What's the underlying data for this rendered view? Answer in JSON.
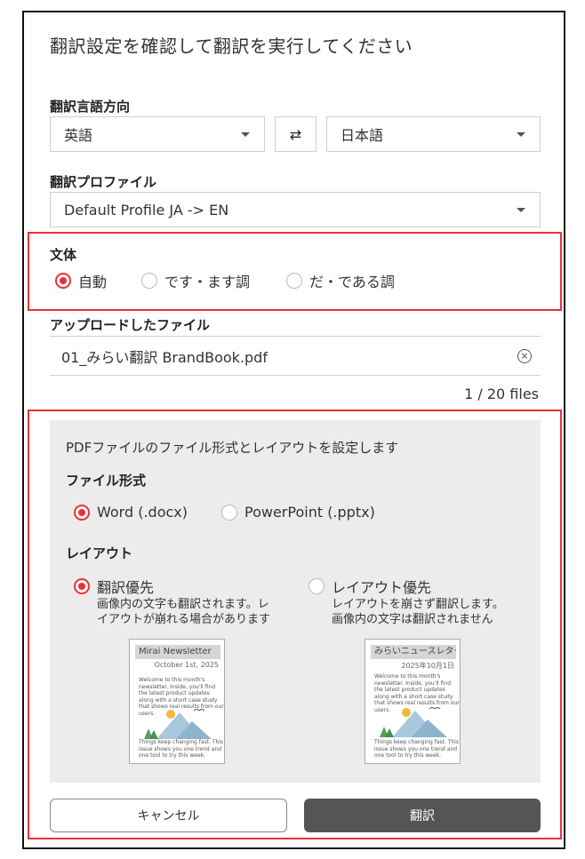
{
  "dialog": {
    "title": "翻訳設定を確認して翻訳を実行してください"
  },
  "language": {
    "label": "翻訳言語方向",
    "source": "英語",
    "target": "日本語",
    "swap_symbol": "⇄"
  },
  "profile": {
    "label": "翻訳プロファイル",
    "value": "Default Profile JA -> EN"
  },
  "style": {
    "label": "文体",
    "options": [
      "自動",
      "です・ます調",
      "だ・である調"
    ],
    "selected": "自動"
  },
  "uploaded": {
    "label": "アップロードしたファイル",
    "filename": "01_みらい翻訳 BrandBook.pdf",
    "count": "1 / 20 files"
  },
  "pdf_settings": {
    "heading": "PDFファイルのファイル形式とレイアウトを設定します",
    "format_label": "ファイル形式",
    "format_options": [
      "Word (.docx)",
      "PowerPoint (.pptx)"
    ],
    "format_selected": "Word (.docx)",
    "layout_label": "レイアウト",
    "layout_options": [
      {
        "label": "翻訳優先",
        "desc_line1": "画像内の文字も翻訳されます。レ",
        "desc_line2": "イアウトが崩れる場合があります",
        "thumb_title": "Mirai Newsletter",
        "thumb_date": "October 1st, 2025",
        "thumb_text1": "Welcome to this month's newsletter. Inside, you'll find the latest product updates along with a short case study that shows real results from our users.",
        "thumb_text2": "Things keep changing fast. This issue shows you one trend and one tool to try this week."
      },
      {
        "label": "レイアウト優先",
        "desc_line1": "レイアウトを崩さず翻訳します。",
        "desc_line2": "画像内の文字は翻訳されません",
        "thumb_title": "みらいニュースレター",
        "thumb_date": "2025年10月1日",
        "thumb_text1": "Welcome to this month's newsletter. Inside, you'll find the latest product updates along with a short case study that shows real results from our users.",
        "thumb_text2": "Things keep changing fast. This issue shows you one trend and one tool to try this week."
      }
    ],
    "layout_selected": "翻訳優先"
  },
  "actions": {
    "cancel": "キャンセル",
    "translate": "翻訳"
  },
  "colors": {
    "accent": "#e53238",
    "primary_button": "#555555"
  },
  "icons": {
    "dropdown": "chevron-down-icon",
    "swap": "swap-arrows-icon",
    "remove_file": "close-circle-icon"
  }
}
